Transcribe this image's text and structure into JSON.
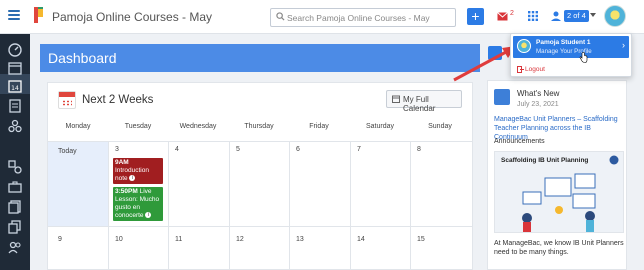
{
  "topbar": {
    "app_title": "Pamoja Online Courses - May",
    "search_placeholder": "Search Pamoja Online Courses - May",
    "plus_label": "+",
    "mail_count": "2",
    "account_switch": "2 of 4"
  },
  "nav": {
    "icons": [
      "dashboard-icon",
      "calendar-icon",
      "calendar-day-icon",
      "list-icon",
      "network-icon",
      "shapes-icon",
      "briefcase-icon",
      "documents-icon",
      "copy-icon",
      "users-icon"
    ]
  },
  "dashboard": {
    "title": "Dashboard"
  },
  "calendar": {
    "title": "Next 2 Weeks",
    "full_calendar_label": "My Full Calendar",
    "days": [
      "Monday",
      "Tuesday",
      "Wednesday",
      "Thursday",
      "Friday",
      "Saturday",
      "Sunday"
    ],
    "week1_labels": [
      "Today",
      "3",
      "4",
      "5",
      "6",
      "7",
      "8"
    ],
    "week2_labels": [
      "9",
      "10",
      "11",
      "12",
      "13",
      "14",
      "15"
    ],
    "events": [
      {
        "time": "9AM",
        "text": "Introduction note",
        "color": "#a11e20"
      },
      {
        "time": "3:50PM",
        "text": "Live Lesson: Mucho gusto en conocerte",
        "color": "#2f9a3a"
      }
    ]
  },
  "whats_new": {
    "title": "What's New",
    "date": "July 23, 2021",
    "link": "ManageBac Unit Planners – Scaffolding Teacher Planning across the IB Continuum",
    "announcements_label": "Announcements",
    "image_title": "Scaffolding IB Unit Planning",
    "announcement_text": "At ManageBac, we know IB Unit Planners need to be many things."
  },
  "profile_menu": {
    "name": "Pamoja Student 1",
    "subtitle": "Manage Your Profile",
    "logout": "Logout"
  },
  "colors": {
    "accent": "#2c7be5",
    "header": "#4c8be6",
    "nav_bg": "#1f2a37",
    "alert": "#d9353a",
    "annotation_arrow": "#e03c3c"
  }
}
